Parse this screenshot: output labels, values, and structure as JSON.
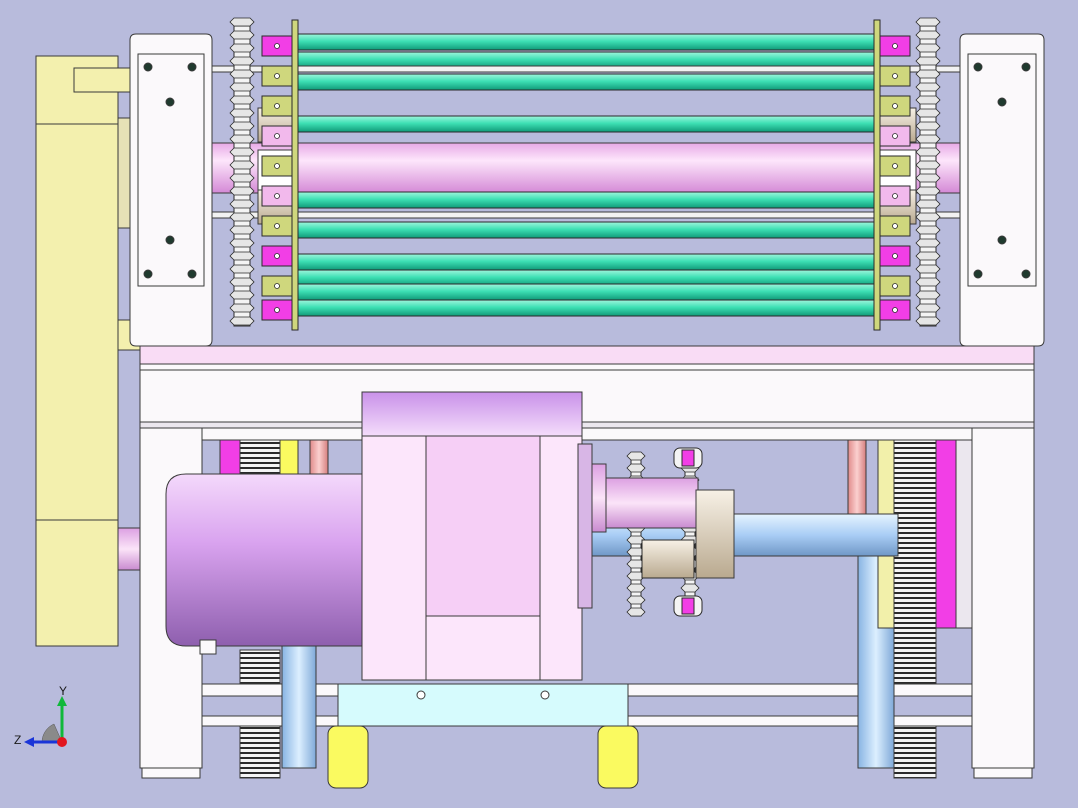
{
  "viewport": {
    "background": "#b8bbdc",
    "palette": {
      "outline": "#2a2a2a",
      "frame_white": "#fbf9fb",
      "shadow_grey": "#cfcbd4",
      "teal_roller": "#3ee0b4",
      "teal_dark": "#15a882",
      "pink_shaft": "#f6c3ee",
      "pink_dark": "#c98bd0",
      "violet_motor": "#d59ef0",
      "violet_dark": "#8a5aa5",
      "magenta": "#f23ee6",
      "olive": "#cfd77d",
      "yellow_pale": "#f2f0aa",
      "yellow_bright": "#fafa60",
      "light_blue": "#a9cdf5",
      "cyan_plate": "#d6fbfd",
      "salmon": "#f2a6a4",
      "gear_grey": "#e6e6e6"
    },
    "roller_bars": 10
  },
  "triad": {
    "x_label": "",
    "y_label": "Y",
    "z_label": "Z",
    "y_color": "#10b83a",
    "z_color": "#1a35d8",
    "origin_color": "#e2151f"
  }
}
